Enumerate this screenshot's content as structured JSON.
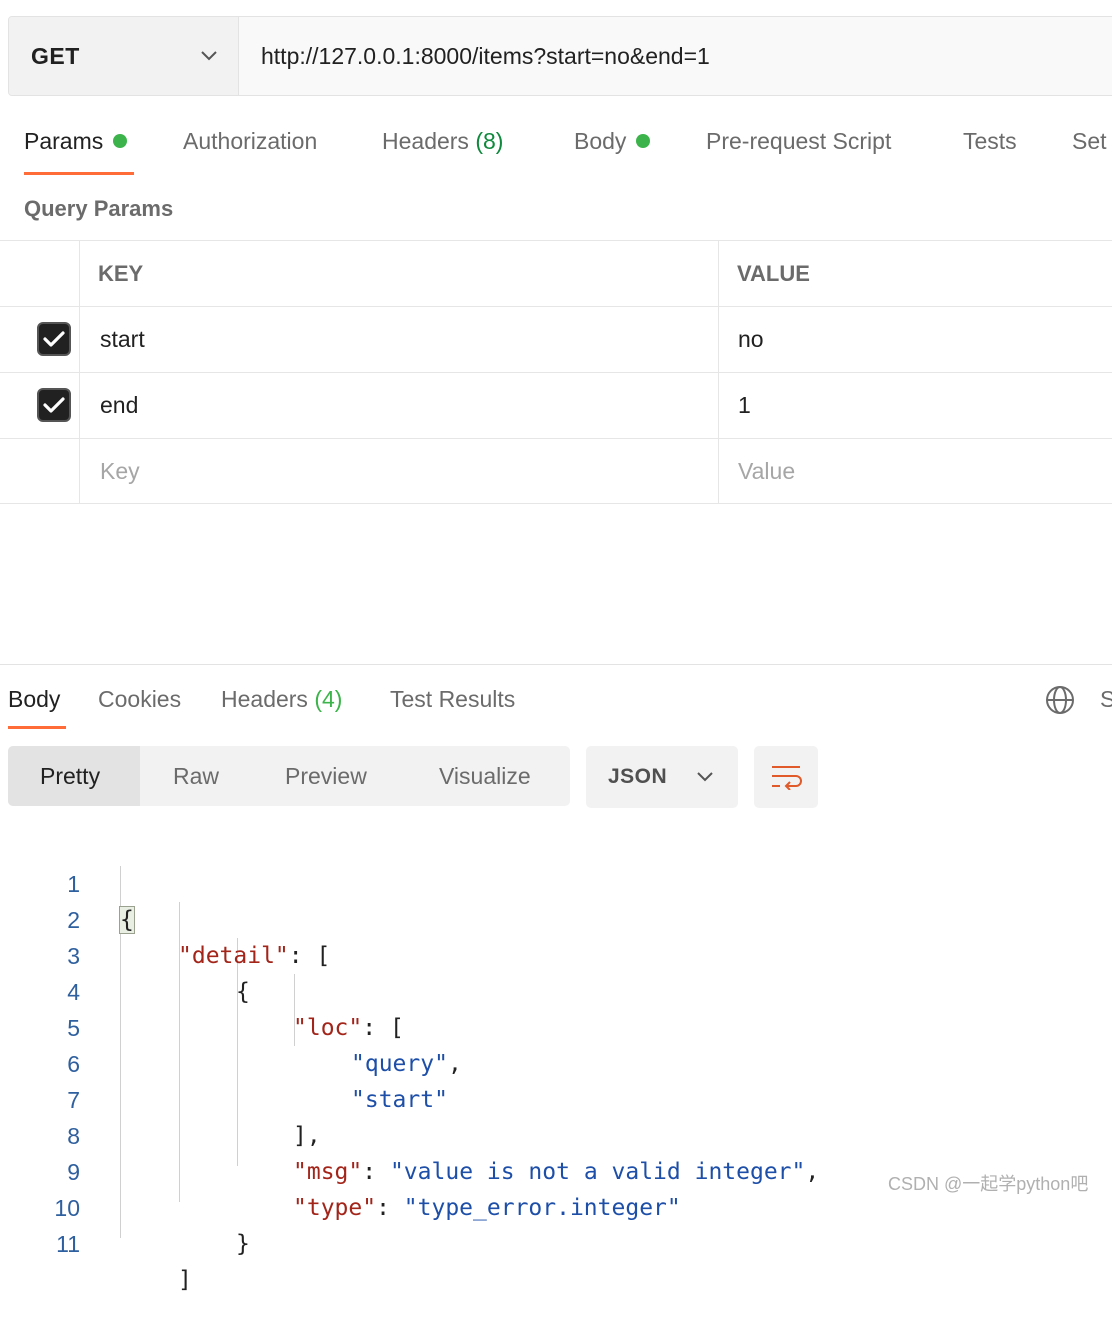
{
  "request": {
    "method": "GET",
    "url": "http://127.0.0.1:8000/items?start=no&end=1"
  },
  "request_tabs": {
    "params": "Params",
    "authorization": "Authorization",
    "headers": "Headers",
    "headers_count": "(8)",
    "body": "Body",
    "prerequest": "Pre-request Script",
    "tests": "Tests",
    "settings": "Set"
  },
  "query_params": {
    "title": "Query Params",
    "key_header": "KEY",
    "value_header": "VALUE",
    "rows": [
      {
        "key": "start",
        "value": "no",
        "checked": true
      },
      {
        "key": "end",
        "value": "1",
        "checked": true
      }
    ],
    "key_placeholder": "Key",
    "value_placeholder": "Value"
  },
  "response_tabs": {
    "body": "Body",
    "cookies": "Cookies",
    "headers": "Headers",
    "headers_count": "(4)",
    "test_results": "Test Results",
    "save": "S"
  },
  "view_modes": {
    "pretty": "Pretty",
    "raw": "Raw",
    "preview": "Preview",
    "visualize": "Visualize",
    "format": "JSON"
  },
  "code": {
    "line_numbers": [
      "1",
      "2",
      "3",
      "4",
      "5",
      "6",
      "7",
      "8",
      "9",
      "10",
      "11"
    ],
    "tokens": {
      "l1": "{",
      "l2_key": "\"detail\"",
      "l2_rest": ": [",
      "l3": "{",
      "l4_key": "\"loc\"",
      "l4_rest": ": [",
      "l5_str": "\"query\"",
      "l5_rest": ",",
      "l6_str": "\"start\"",
      "l7": "],",
      "l8_key": "\"msg\"",
      "l8_colon": ": ",
      "l8_str": "\"value is not a valid integer\"",
      "l8_rest": ",",
      "l9_key": "\"type\"",
      "l9_colon": ": ",
      "l9_str": "\"type_error.integer\"",
      "l10": "}",
      "l11": "]"
    }
  },
  "watermark": "CSDN @一起学python吧",
  "colors": {
    "accent": "#ff6c37",
    "status_dot": "#3cb44b",
    "json_key": "#a3251a",
    "json_string": "#1e4fa8"
  }
}
